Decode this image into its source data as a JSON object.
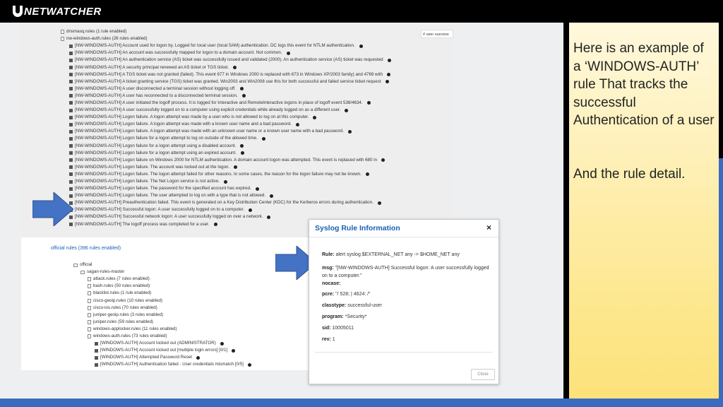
{
  "brand": {
    "name": "NETWATCHER"
  },
  "side": {
    "description": "Here is an example of a ‘WINDOWS-AUTH’ rule That tracks the successful Authentication of a user",
    "note": "And the rule detail."
  },
  "top_panel": {
    "search_tag": "# user success",
    "groups": [
      "dnsmasq.rules (1 rule enabled)",
      "nw-windows-auth.rules (26 rules enabled)"
    ],
    "rules": [
      "[NW-WINDOWS-AUTH] Account used for logon by. Logged for local user (local SAM) authentication. DC logs this event for NTLM authentication.",
      "[NW-WINDOWS-AUTH] An account was successfully mapped for logon to a domain account. Not common.",
      "[NW-WINDOWS-AUTH] An authentication service (AS) ticket was successfully issued and validated (2000). An authentication service (AS) ticket was requested",
      "[NW-WINDOWS-AUTH] A security principal renewed an AS ticket or TGS ticket.",
      "[NW-WINDOWS-AUTH] A TGS ticket was not granted (failed). This event 677 in Windows 2000 is replaced with 673 in Windows XP/2003 family) and 4769 with",
      "[NW-WINDOWS-AUTH] A ticket granting service (TGS) ticket was granted. Win2003 and Win2008 use this for both successful and failed service ticket request",
      "[NW-WINDOWS-AUTH] A user disconnected a terminal session without logging off.",
      "[NW-WINDOWS-AUTH] A user has reconnected to a disconnected terminal session.",
      "[NW-WINDOWS-AUTH] A user initiated the logoff process. It is logged for Interactive and RemoteInteractive logons in place of logoff event 538/4634.",
      "[NW-WINDOWS-AUTH] A user successfully logged on to a computer using explicit credentials while already logged on as a different user.",
      "[NW-WINDOWS-AUTH] Logon failure. A logon attempt was made by a user who is not allowed to log on at this computer.",
      "[NW-WINDOWS-AUTH] Logon failure. A logon attempt was made with a known user name and a bad password.",
      "[NW-WINDOWS-AUTH] Logon failure. A logon attempt was made with an unknown user name or a known user name with a bad password.",
      "[NW-WINDOWS-AUTH] Logon failure for a logon attempt to log on outside of the allowed time.",
      "[NW-WINDOWS-AUTH] Logon failure for a logon attempt using a disabled account.",
      "[NW-WINDOWS-AUTH] Logon failure for a logon attempt using an expired account.",
      "[NW-WINDOWS-AUTH] Logon failure on Windows 2000 for NTLM authentication. A domain account logon was attempted. This event is replaced with 680 in",
      "[NW-WINDOWS-AUTH] Logon failure. The account was locked out at the logon.",
      "[NW-WINDOWS-AUTH] Logon failure. The logon attempt failed for other reasons. In some cases, the reason for the logon failure may not be known.",
      "[NW-WINDOWS-AUTH] Logon failure. The Net Logon service is not active.",
      "[NW-WINDOWS-AUTH] Logon failure. The password for the specified account has expired.",
      "[NW-WINDOWS-AUTH] Logon failure. The user attempted to log on with a type that is not allowed.",
      "[NW-WINDOWS-AUTH] Preauthentication failed. This event is generated on a Key Distribution Center (KDC) for the Kerberos errors during authentication.",
      "[NW-WINDOWS-AUTH] Successful logon: A user successfully logged on to a computer.",
      "[NW-WINDOWS-AUTH] Successful network logon: A user successfully logged on over a network.",
      "[NW-WINDOWS-AUTH] The logoff process was completed for a user."
    ]
  },
  "bottom_panel": {
    "heading": "official rules (396 rules enabled)",
    "tree": [
      {
        "label": "official",
        "level": 0,
        "kind": "folder"
      },
      {
        "label": "sagan-rules-master",
        "level": 1,
        "kind": "folder"
      },
      {
        "label": "attack.rules (7 rules enabled)",
        "level": 2,
        "kind": "file"
      },
      {
        "label": "bash.rules (50 rules enabled)",
        "level": 2,
        "kind": "file"
      },
      {
        "label": "blacklist.rules (1 rule enabled)",
        "level": 2,
        "kind": "file"
      },
      {
        "label": "cisco-geoip.rules (10 rules enabled)",
        "level": 2,
        "kind": "file"
      },
      {
        "label": "cisco-ios.rules (70 rules enabled)",
        "level": 2,
        "kind": "file"
      },
      {
        "label": "juniper-geoip.rules (3 rules enabled)",
        "level": 2,
        "kind": "file"
      },
      {
        "label": "juniper.rules (59 rules enabled)",
        "level": 2,
        "kind": "file"
      },
      {
        "label": "windows-applocker.rules (11 rules enabled)",
        "level": 2,
        "kind": "file"
      },
      {
        "label": "windows-auth.rules (73 rules enabled)",
        "level": 2,
        "kind": "file"
      },
      {
        "label": "[WINDOWS-AUTH] Account locked out (ADMINISTRATOR)",
        "level": 3,
        "kind": "rule"
      },
      {
        "label": "[WINDOWS-AUTH] Account locked out [multiple login errors] [0/1]",
        "level": 3,
        "kind": "rule"
      },
      {
        "label": "[WINDOWS-AUTH] Attempted Password Reset",
        "level": 3,
        "kind": "rule"
      },
      {
        "label": "[WINDOWS-AUTH] Authentication failed - User credentials mismatch [0/5]",
        "level": 3,
        "kind": "rule"
      }
    ]
  },
  "modal": {
    "title": "Syslog Rule Information",
    "close_glyph": "×",
    "fields": [
      {
        "key": "Rule:",
        "value": " alert syslog $EXTERNAL_NET any -> $HOME_NET any"
      },
      {
        "key": "msg:",
        "value": " \"[NW-WINDOWS-AUTH] Successful logon: A user successfully logged on to a computer.\""
      },
      {
        "key": "nocase:",
        "value": ""
      },
      {
        "key": "pcre:",
        "value": " \"/ 528; | 4624: /\""
      },
      {
        "key": "classtype:",
        "value": " successful-user"
      },
      {
        "key": "program:",
        "value": " *Security*"
      },
      {
        "key": "sid:",
        "value": " 10005011"
      },
      {
        "key": "rev:",
        "value": " 1"
      }
    ],
    "close_button": "Close"
  },
  "colors": {
    "accent_blue": "#3a6bbf",
    "link_blue": "#1a5fb4",
    "arrow_blue": "#4472c4",
    "sidebar_yellow": "#fde68a"
  }
}
